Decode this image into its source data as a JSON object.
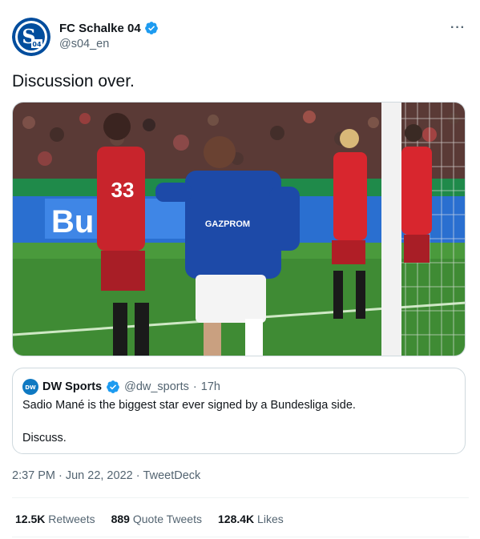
{
  "author": {
    "display_name": "FC Schalke 04",
    "handle": "@s04_en",
    "avatar_letters": "S04"
  },
  "tweet": {
    "text": "Discussion over."
  },
  "media": {
    "jersey_sponsor": "GAZPROM",
    "player_number": "33",
    "ad_board": "Bu"
  },
  "quoted": {
    "display_name": "DW Sports",
    "handle": "@dw_sports",
    "time": "17h",
    "line1": "Sadio Mané is the biggest star ever signed by a Bundesliga side.",
    "line2": "Discuss."
  },
  "meta": {
    "time": "2:37 PM",
    "date": "Jun 22, 2022",
    "source": "TweetDeck"
  },
  "stats": {
    "retweets_count": "12.5K",
    "retweets_label": "Retweets",
    "quotes_count": "889",
    "quotes_label": "Quote Tweets",
    "likes_count": "128.4K",
    "likes_label": "Likes"
  },
  "colors": {
    "verified": "#1d9bf0",
    "schalke_blue": "#004d9d",
    "muted": "#536471"
  }
}
